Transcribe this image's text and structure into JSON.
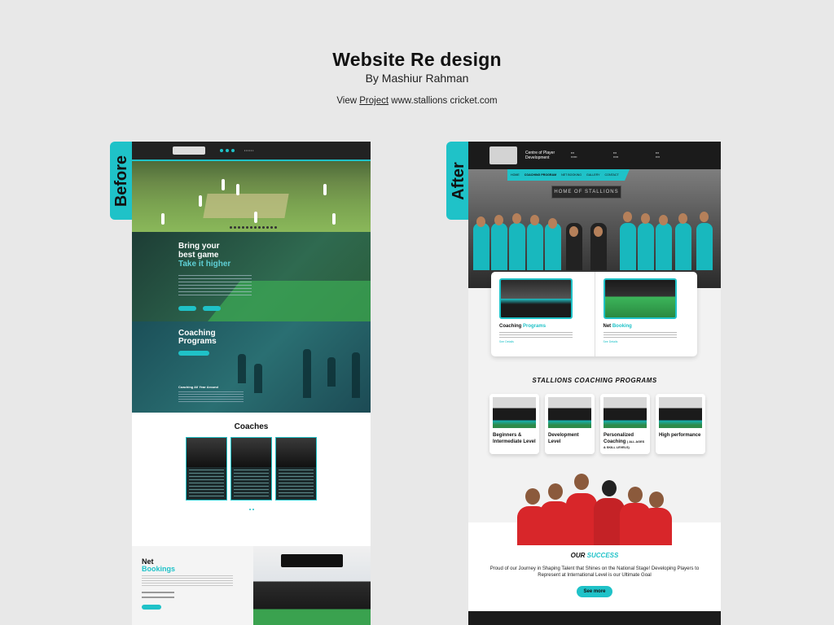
{
  "header": {
    "title": "Website Re design",
    "byline": "By Mashiur Rahman",
    "view_prefix": "View",
    "view_link": "Project",
    "view_url": "www.stallions cricket.com"
  },
  "tags": {
    "before": "Before",
    "after": "After"
  },
  "before": {
    "hero_title_1": "Bring your best game",
    "hero_title_2": "Take it higher",
    "programs_title": "Coaching Programs",
    "programs_sub": "Coaching All Year Around",
    "coaches_title": "Coaches",
    "net_title_1": "Net",
    "net_title_2": "Bookings"
  },
  "after": {
    "top_tagline": "Centre of Player Development",
    "nav": [
      "HOME",
      "COACHING PROGRAM",
      "NET BOOKING",
      "GALLERY",
      "CONTACT"
    ],
    "hero_banner": "HOME OF STALLIONS",
    "card_1": {
      "title_a": "Coaching",
      "title_b": "Programs",
      "link": "See Details"
    },
    "card_2": {
      "title_a": "Net",
      "title_b": "Booking",
      "link": "See Details"
    },
    "programs_title": "STALLIONS COACHING PROGRAMS",
    "programs": [
      {
        "label": "Beginners & Intermediate Level"
      },
      {
        "label": "Development Level"
      },
      {
        "label": "Personalized Coaching",
        "sub": "( ALL AGES & SKILL LEVELS)"
      },
      {
        "label": "High performance"
      }
    ],
    "success_a": "OUR",
    "success_b": "SUCCESS",
    "success_text": "Proud of our Journey in Shaping Talent that Shines on the National Stage! Developing Players to Represent at International Level is our Ultimate Goal",
    "see_more": "See more"
  }
}
